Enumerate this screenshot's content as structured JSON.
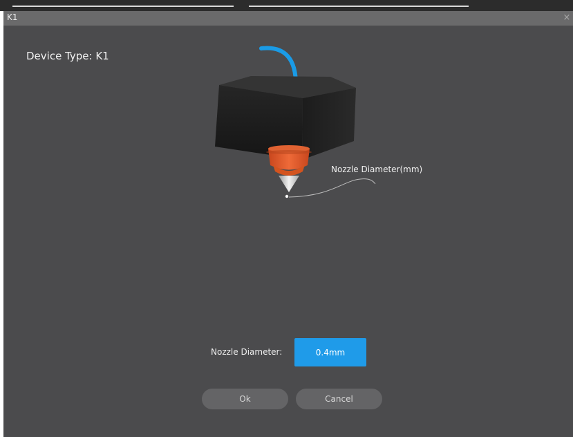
{
  "window": {
    "title": "K1",
    "close_glyph": "×"
  },
  "device": {
    "type_label": "Device Type: K1"
  },
  "illustration": {
    "callout_label": "Nozzle Diameter(mm)"
  },
  "nozzle": {
    "label": "Nozzle Diameter:",
    "value": "0.4mm"
  },
  "buttons": {
    "ok": "Ok",
    "cancel": "Cancel"
  },
  "colors": {
    "dialog_bg": "#4b4b4d",
    "titlebar_bg": "#6a6a6b",
    "accent_blue": "#1f9be9",
    "button_bg": "#646466",
    "nozzle_orange": "#e55a2b",
    "filament_blue": "#1a9be6"
  },
  "icons": {
    "close": "close-icon"
  }
}
